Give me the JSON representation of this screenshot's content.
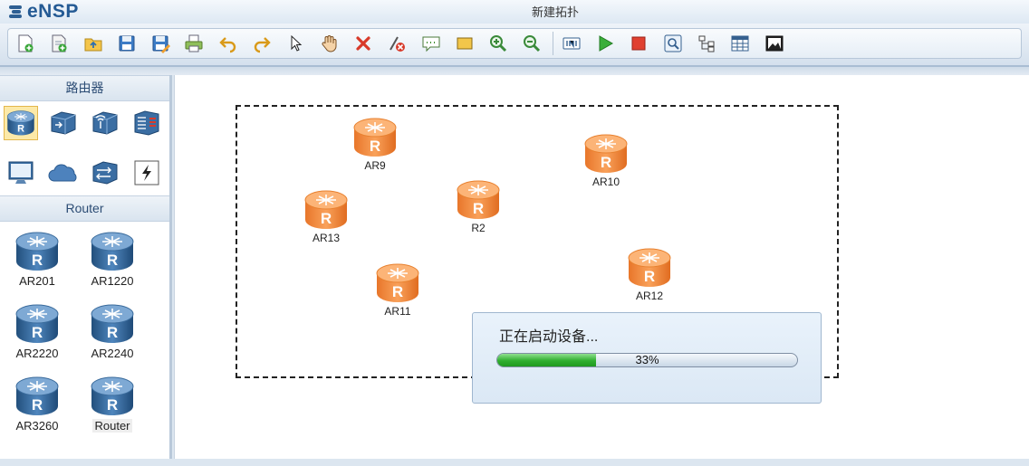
{
  "app": {
    "name": "eNSP",
    "window_title": "新建拓扑"
  },
  "toolbar": {
    "icons": [
      "new-topology-icon",
      "new-lab-icon",
      "open-icon",
      "save-icon",
      "save-as-icon",
      "print-icon",
      "undo-icon",
      "redo-icon",
      "select-icon",
      "pan-hand-icon",
      "delete-icon",
      "delete-link-icon",
      "text-annotation-icon",
      "rectangle-icon",
      "zoom-in-icon",
      "zoom-reset-icon",
      "interface-label-icon",
      "start-device-icon",
      "stop-device-icon",
      "capture-icon",
      "topology-icon",
      "grid-icon",
      "screenshot-icon"
    ]
  },
  "sidebar": {
    "category_title": "路由器",
    "category_icons": [
      "router-category-icon",
      "switch-category-icon",
      "wireless-category-icon",
      "firewall-category-icon",
      "pc-terminal-icon",
      "cloud-icon",
      "other-devices-icon",
      "custom-device-icon"
    ],
    "device_section_title": "Router",
    "devices": [
      {
        "label": "AR201"
      },
      {
        "label": "AR1220"
      },
      {
        "label": "AR2220"
      },
      {
        "label": "AR2240"
      },
      {
        "label": "AR3260"
      },
      {
        "label": "Router"
      }
    ]
  },
  "canvas": {
    "nodes": [
      {
        "label": "AR9"
      },
      {
        "label": "AR10"
      },
      {
        "label": "AR13"
      },
      {
        "label": "R2"
      },
      {
        "label": "AR11"
      },
      {
        "label": "AR12"
      }
    ]
  },
  "progress": {
    "message": "正在启动设备...",
    "percent_text": "33%",
    "fraction": 0.33
  },
  "colors": {
    "router_orange": "#f08a3c",
    "router_blue": "#2f6699",
    "progress_green": "#2fae2f",
    "brand_blue": "#245a94"
  }
}
